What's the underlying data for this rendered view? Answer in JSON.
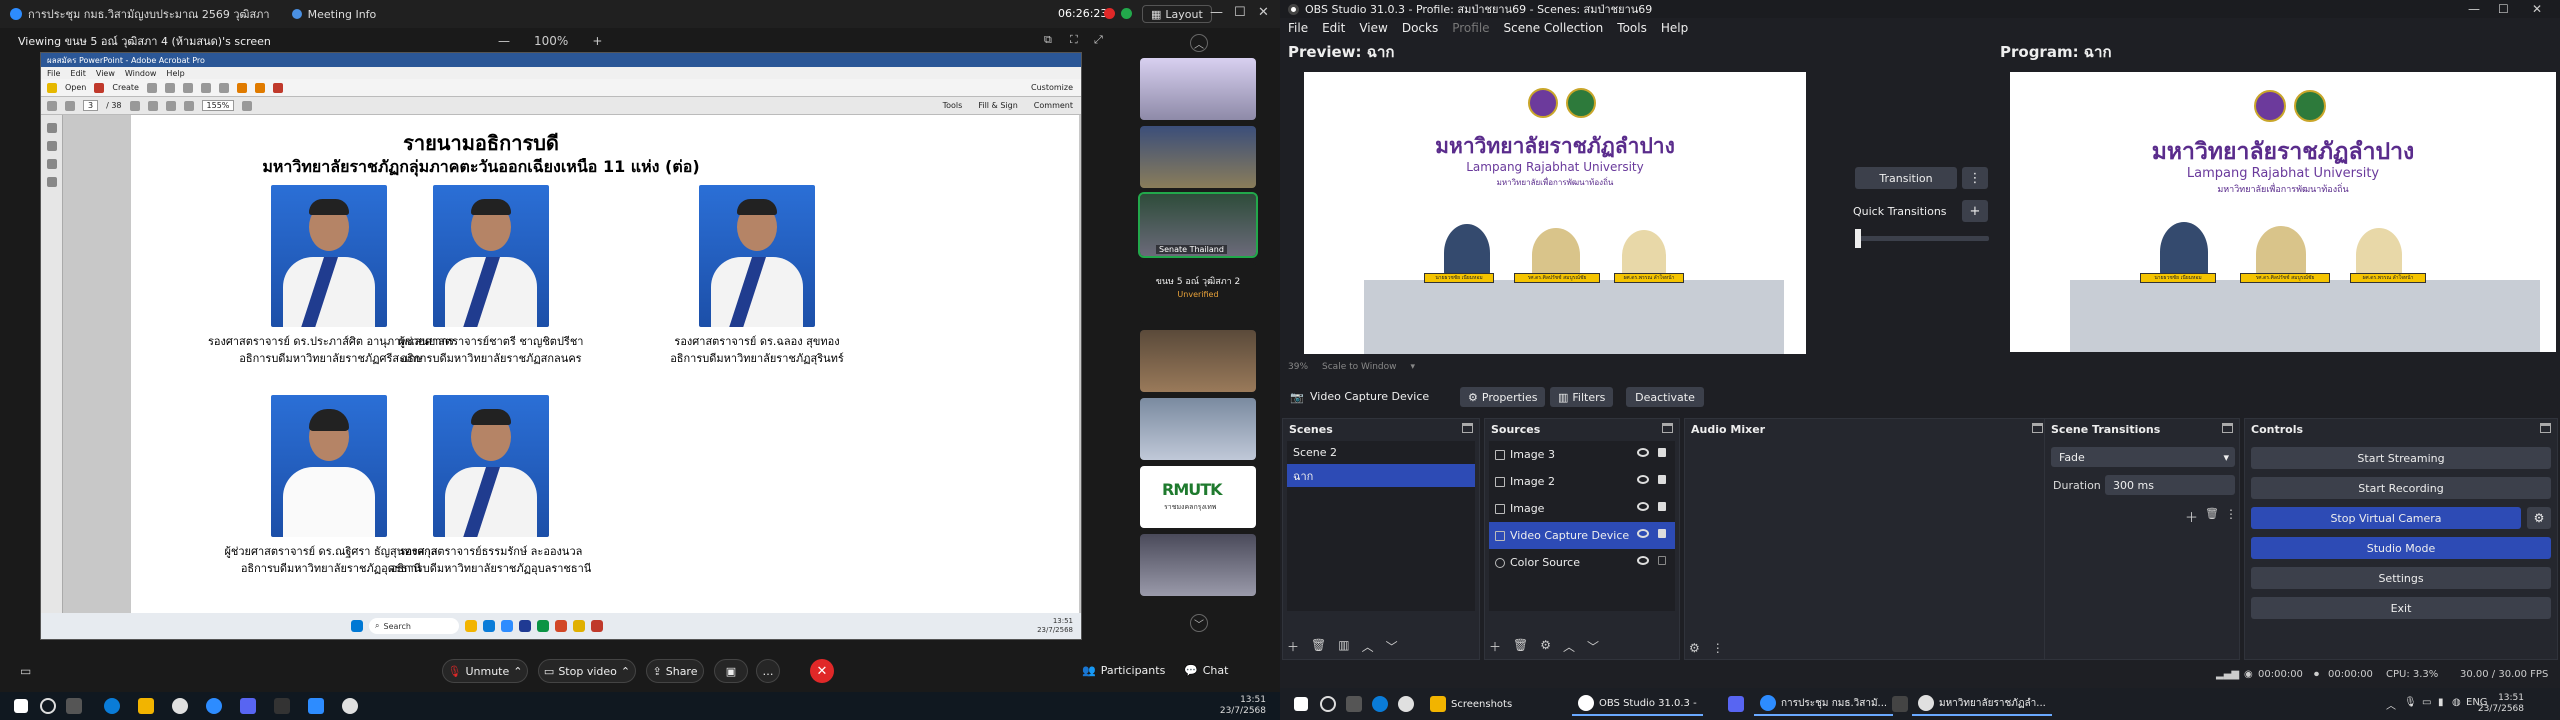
{
  "zoom": {
    "title": "การประชุม กมธ.วิสามัญงบประมาณ 2569 วุฒิสภา",
    "meeting_info": "Meeting Info",
    "clock": "06:26:23",
    "layout_label": "Layout",
    "viewing": "Viewing ขนษ 5 อณ์ วุฒิสภา 4 (ห้ามสนด)'s screen",
    "zoom_level": "100%",
    "zoom_minus": "—",
    "zoom_plus": "+",
    "acrobat": {
      "window_title": "ผลสมัคร PowerPoint - Adobe Acrobat Pro",
      "menu": [
        "File",
        "Edit",
        "View",
        "Window",
        "Help"
      ],
      "open_label": "Open",
      "create_label": "Create",
      "customize_label": "Customize",
      "page_indicator": "3",
      "page_total": "/ 38",
      "zoom_pct": "155%",
      "tools_label": "Tools",
      "fill_sign_label": "Fill & Sign",
      "comment_label": "Comment"
    },
    "slide": {
      "title": "รายนามอธิการบดี",
      "subtitle": "มหาวิทยาลัยราชภัฏกลุ่มภาคตะวันออกเฉียงเหนือ 11 แห่ง (ต่อ)",
      "people": [
        {
          "name": "รองศาสตราจารย์ ดร.ประภาส์ศิต อานุภาพแสนยากร",
          "role": "อธิการบดีมหาวิทยาลัยราชภัฏศรีสะเกษ"
        },
        {
          "name": "ผู้ช่วยศาสตราจารย์ชาตรี ชาญชิตปรีชา",
          "role": "อธิการบดีมหาวิทยาลัยราชภัฏสกลนคร"
        },
        {
          "name": "รองศาสตราจารย์ ดร.ฉลอง สุขทอง",
          "role": "อธิการบดีมหาวิทยาลัยราชภัฏสุรินทร์"
        },
        {
          "name": "ผู้ช่วยศาสตราจารย์ ดร.ณฐิศรา ธัญสุนทรสกุล",
          "role": "อธิการบดีมหาวิทยาลัยราชภัฏอุดรธานี"
        },
        {
          "name": "รองศาสตราจารย์ธรรมรักษ์ ละอองนวล",
          "role": "อธิการบดีมหาวิทยาลัยราชภัฏอุบลราชธานี"
        }
      ]
    },
    "inner_taskbar": {
      "search": "Search",
      "time": "13:51",
      "date": "23/7/2568"
    },
    "gallery": {
      "active_label": "Senate Thailand",
      "black_tile_name": "ขนษ 5 อณ์ วุฒิสภา 2",
      "black_tile_status": "Unverified",
      "logo_text": "RMUTK",
      "logo_sub": "ราชมงคลกรุงเทพ"
    },
    "toolbar": {
      "unmute": "Unmute",
      "stop_video": "Stop video",
      "share": "Share",
      "participants": "Participants",
      "chat": "Chat"
    },
    "taskbar": {
      "time": "13:51",
      "date": "23/7/2568"
    }
  },
  "obs": {
    "title": "OBS Studio 31.0.3 - Profile: สมป่าชยาน69 - Scenes: สมป่าชยาน69",
    "menu": [
      "File",
      "Edit",
      "View",
      "Docks",
      "Profile",
      "Scene Collection",
      "Tools",
      "Help"
    ],
    "preview_label": "Preview: ฉาก",
    "program_label": "Program: ฉาก",
    "canvas": {
      "thai_name": "มหาวิทยาลัยราชภัฏลำปาง",
      "english_name": "Lampang Rajabhat University",
      "slogan": "มหาวิทยาลัยเพื่อการพัฒนาท้องถิ่น",
      "plates": [
        "นายธวชชัย เนียมหอม",
        "รศ.ดร.ศิลปรัชช์ สมบูรณ์ชัย",
        "ผศ.ดร.พรรณ ลำใจหน้า"
      ]
    },
    "zoom_pct": "39%",
    "scale_label": "Scale to Window",
    "transition_label": "Transition",
    "quick_transitions_label": "Quick Transitions",
    "source_toolbar": {
      "source_name": "Video Capture Device",
      "properties": "Properties",
      "filters": "Filters",
      "deactivate": "Deactivate"
    },
    "scenes": {
      "title": "Scenes",
      "items": [
        "Scene 2",
        "ฉาก"
      ]
    },
    "sources": {
      "title": "Sources",
      "items": [
        "Image 3",
        "Image 2",
        "Image",
        "Video Capture Device",
        "Color Source"
      ]
    },
    "audio_mixer": {
      "title": "Audio Mixer"
    },
    "scene_transitions": {
      "title": "Scene Transitions",
      "type": "Fade",
      "duration_label": "Duration",
      "duration_value": "300 ms"
    },
    "controls": {
      "title": "Controls",
      "start_streaming": "Start Streaming",
      "start_recording": "Start Recording",
      "stop_virtual_camera": "Stop Virtual Camera",
      "studio_mode": "Studio Mode",
      "settings": "Settings",
      "exit": "Exit"
    },
    "status": {
      "stream_time": "00:00:00",
      "record_time": "00:00:00",
      "cpu": "CPU: 3.3%",
      "fps": "30.00 / 30.00 FPS"
    },
    "taskbar": {
      "screenshots": "Screenshots",
      "obs_app": "OBS Studio 31.0.3 -",
      "zoom_app": "การประชุม กมธ.วิสามั...",
      "chrome_app": "มหาวิทยาลัยราชภัฏลำ...",
      "lang": "ENG",
      "time": "13:51",
      "date": "23/7/2568"
    }
  }
}
